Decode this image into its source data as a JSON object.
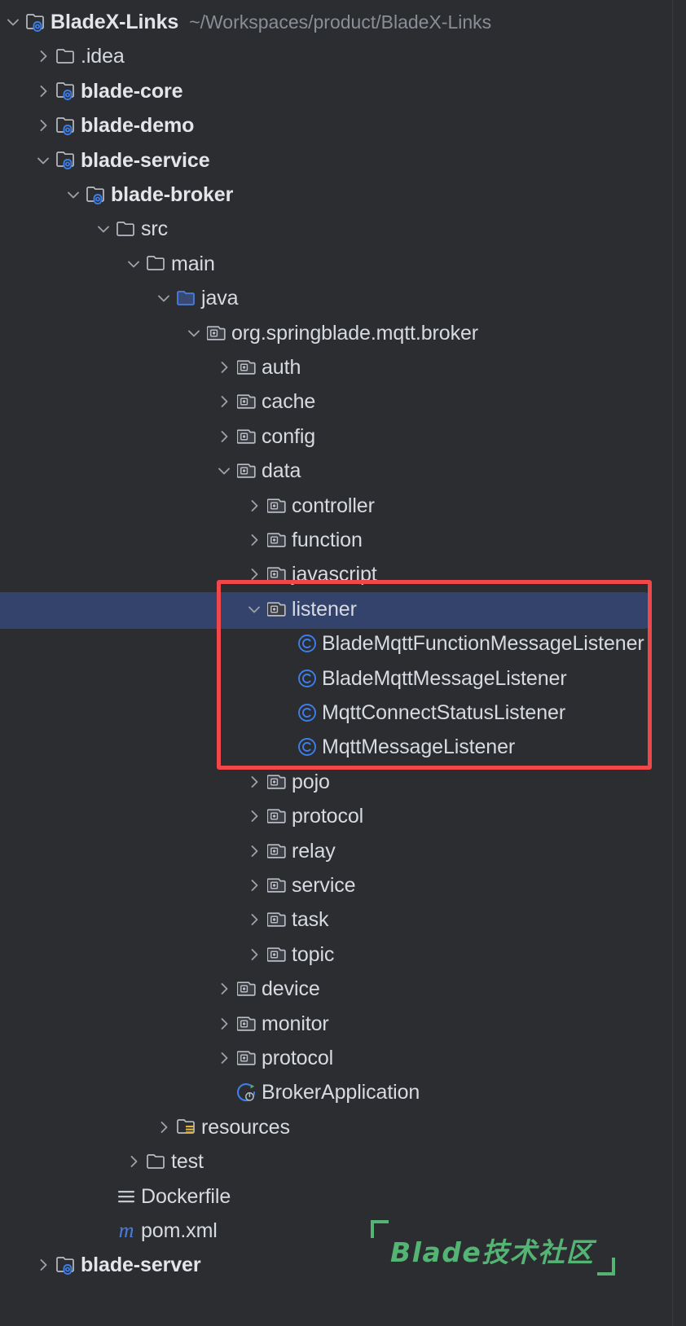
{
  "window": {
    "background_color": "#2b2d30",
    "selection_color": "#34436b",
    "annotation_color": "#f0474a",
    "watermark_color": "#54b474"
  },
  "project": {
    "name": "BladeX-Links",
    "path": "~/Workspaces/product/BladeX-Links"
  },
  "watermark": {
    "text": "Blade技术社区"
  },
  "tree": [
    {
      "label": "BladeX-Links",
      "path": "~/Workspaces/product/BladeX-Links",
      "icon": "module-icon",
      "arrow": "expanded",
      "depth": 0,
      "bold": true
    },
    {
      "label": ".idea",
      "icon": "folder-icon",
      "arrow": "collapsed",
      "depth": 1,
      "bold": false
    },
    {
      "label": "blade-core",
      "icon": "module-icon",
      "arrow": "collapsed",
      "depth": 1,
      "bold": true
    },
    {
      "label": "blade-demo",
      "icon": "module-icon",
      "arrow": "collapsed",
      "depth": 1,
      "bold": true
    },
    {
      "label": "blade-service",
      "icon": "module-icon",
      "arrow": "expanded",
      "depth": 1,
      "bold": true
    },
    {
      "label": "blade-broker",
      "icon": "module-icon",
      "arrow": "expanded",
      "depth": 2,
      "bold": true
    },
    {
      "label": "src",
      "icon": "folder-icon",
      "arrow": "expanded",
      "depth": 3,
      "bold": false
    },
    {
      "label": "main",
      "icon": "folder-icon",
      "arrow": "expanded",
      "depth": 4,
      "bold": false
    },
    {
      "label": "java",
      "icon": "source-folder-icon",
      "arrow": "expanded",
      "depth": 5,
      "bold": false
    },
    {
      "label": "org.springblade.mqtt.broker",
      "icon": "package-icon",
      "arrow": "expanded",
      "depth": 6,
      "bold": false
    },
    {
      "label": "auth",
      "icon": "package-icon",
      "arrow": "collapsed",
      "depth": 7,
      "bold": false
    },
    {
      "label": "cache",
      "icon": "package-icon",
      "arrow": "collapsed",
      "depth": 7,
      "bold": false
    },
    {
      "label": "config",
      "icon": "package-icon",
      "arrow": "collapsed",
      "depth": 7,
      "bold": false
    },
    {
      "label": "data",
      "icon": "package-icon",
      "arrow": "expanded",
      "depth": 7,
      "bold": false
    },
    {
      "label": "controller",
      "icon": "package-icon",
      "arrow": "collapsed",
      "depth": 8,
      "bold": false
    },
    {
      "label": "function",
      "icon": "package-icon",
      "arrow": "collapsed",
      "depth": 8,
      "bold": false
    },
    {
      "label": "javascript",
      "icon": "package-icon",
      "arrow": "collapsed",
      "depth": 8,
      "bold": false
    },
    {
      "label": "listener",
      "icon": "package-icon",
      "arrow": "expanded",
      "depth": 8,
      "bold": false,
      "selected": true
    },
    {
      "label": "BladeMqttFunctionMessageListener",
      "icon": "class-icon",
      "arrow": "none",
      "depth": 9,
      "bold": false
    },
    {
      "label": "BladeMqttMessageListener",
      "icon": "class-icon",
      "arrow": "none",
      "depth": 9,
      "bold": false
    },
    {
      "label": "MqttConnectStatusListener",
      "icon": "class-icon",
      "arrow": "none",
      "depth": 9,
      "bold": false
    },
    {
      "label": "MqttMessageListener",
      "icon": "class-icon",
      "arrow": "none",
      "depth": 9,
      "bold": false
    },
    {
      "label": "pojo",
      "icon": "package-icon",
      "arrow": "collapsed",
      "depth": 8,
      "bold": false
    },
    {
      "label": "protocol",
      "icon": "package-icon",
      "arrow": "collapsed",
      "depth": 8,
      "bold": false
    },
    {
      "label": "relay",
      "icon": "package-icon",
      "arrow": "collapsed",
      "depth": 8,
      "bold": false
    },
    {
      "label": "service",
      "icon": "package-icon",
      "arrow": "collapsed",
      "depth": 8,
      "bold": false
    },
    {
      "label": "task",
      "icon": "package-icon",
      "arrow": "collapsed",
      "depth": 8,
      "bold": false
    },
    {
      "label": "topic",
      "icon": "package-icon",
      "arrow": "collapsed",
      "depth": 8,
      "bold": false
    },
    {
      "label": "device",
      "icon": "package-icon",
      "arrow": "collapsed",
      "depth": 7,
      "bold": false
    },
    {
      "label": "monitor",
      "icon": "package-icon",
      "arrow": "collapsed",
      "depth": 7,
      "bold": false
    },
    {
      "label": "protocol",
      "icon": "package-icon",
      "arrow": "collapsed",
      "depth": 7,
      "bold": false
    },
    {
      "label": "BrokerApplication",
      "icon": "spring-boot-icon",
      "arrow": "none",
      "depth": 7,
      "bold": false
    },
    {
      "label": "resources",
      "icon": "resources-folder-icon",
      "arrow": "collapsed",
      "depth": 5,
      "bold": false
    },
    {
      "label": "test",
      "icon": "folder-icon",
      "arrow": "collapsed",
      "depth": 4,
      "bold": false
    },
    {
      "label": "Dockerfile",
      "icon": "dockerfile-icon",
      "arrow": "none",
      "depth": 3,
      "bold": false
    },
    {
      "label": "pom.xml",
      "icon": "maven-icon",
      "arrow": "none",
      "depth": 3,
      "bold": false
    },
    {
      "label": "blade-server",
      "icon": "module-icon",
      "arrow": "collapsed",
      "depth": 1,
      "bold": true
    }
  ]
}
